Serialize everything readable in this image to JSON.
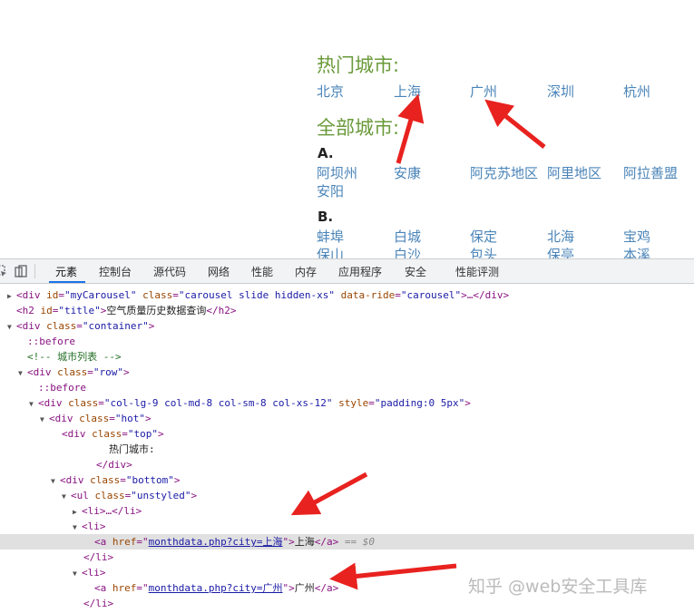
{
  "page": {
    "hot_title": "热门城市:",
    "all_title": "全部城市:",
    "hot_cities": [
      "北京",
      "上海",
      "广州",
      "深圳",
      "杭州"
    ],
    "group_a": {
      "letter": "A.",
      "cities": [
        "阿坝州",
        "安康",
        "阿克苏地区",
        "阿里地区",
        "阿拉善盟",
        "安阳"
      ]
    },
    "group_b": {
      "letter": "B.",
      "cities": [
        "蚌埠",
        "白城",
        "保定",
        "北海",
        "宝鸡",
        "保山",
        "白沙",
        "包头",
        "保亭",
        "本溪"
      ]
    }
  },
  "devtools": {
    "tabs": [
      "元素",
      "控制台",
      "源代码",
      "网络",
      "性能",
      "内存",
      "应用程序",
      "安全",
      "性能评测"
    ],
    "active_tab": "元素",
    "dom_lines": {
      "l1": {
        "tag": "div",
        "a1": "id",
        "v1": "\"myCarousel\"",
        "a2": "class",
        "v2": "\"carousel slide hidden-xs\"",
        "a3": "data-ride",
        "v3": "\"carousel\"",
        "tail": ">…</div>"
      },
      "l2": {
        "tag": "h2",
        "a1": "id",
        "v1": "\"title\"",
        "text": "空气质量历史数据查询",
        "close": "</h2>"
      },
      "l3": {
        "tag": "div",
        "a1": "class",
        "v1": "\"container\""
      },
      "l4": {
        "pseudo": "::before"
      },
      "l5": {
        "comment": "<!-- 城市列表 -->"
      },
      "l6": {
        "tag": "div",
        "a1": "class",
        "v1": "\"row\""
      },
      "l7": {
        "pseudo": "::before"
      },
      "l8": {
        "tag": "div",
        "a1": "class",
        "v1": "\"col-lg-9 col-md-8 col-sm-8 col-xs-12\"",
        "a2": "style",
        "v2": "\"padding:0 5px\""
      },
      "l9": {
        "tag": "div",
        "a1": "class",
        "v1": "\"hot\""
      },
      "l10": {
        "tag": "div",
        "a1": "class",
        "v1": "\"top\""
      },
      "l11": {
        "text": "热门城市:"
      },
      "l12": {
        "close": "</div>"
      },
      "l13": {
        "tag": "div",
        "a1": "class",
        "v1": "\"bottom\""
      },
      "l14": {
        "tag": "ul",
        "a1": "class",
        "v1": "\"unstyled\""
      },
      "l15": {
        "collapsed": "<li>…</li>"
      },
      "l16": {
        "open": "<li>"
      },
      "l17": {
        "tag": "a",
        "a1": "href",
        "v1": "monthdata.php?city=上海",
        "text": "上海",
        "close": "</a>",
        "eq": "== $0"
      },
      "l18": {
        "close": "</li>"
      },
      "l19": {
        "open": "<li>"
      },
      "l20": {
        "tag": "a",
        "a1": "href",
        "v1": "monthdata.php?city=广州",
        "text": "广州",
        "close": "</a>"
      },
      "l21": {
        "close": "</li>"
      }
    }
  },
  "watermark": "知乎 @web安全工具库",
  "colors": {
    "title_green": "#6a9a3a",
    "link_blue": "#4a84b8",
    "arrow_red": "#e8221f",
    "tag_purple": "#881280",
    "attr_name": "#994500",
    "attr_value": "#1a1aa6"
  }
}
